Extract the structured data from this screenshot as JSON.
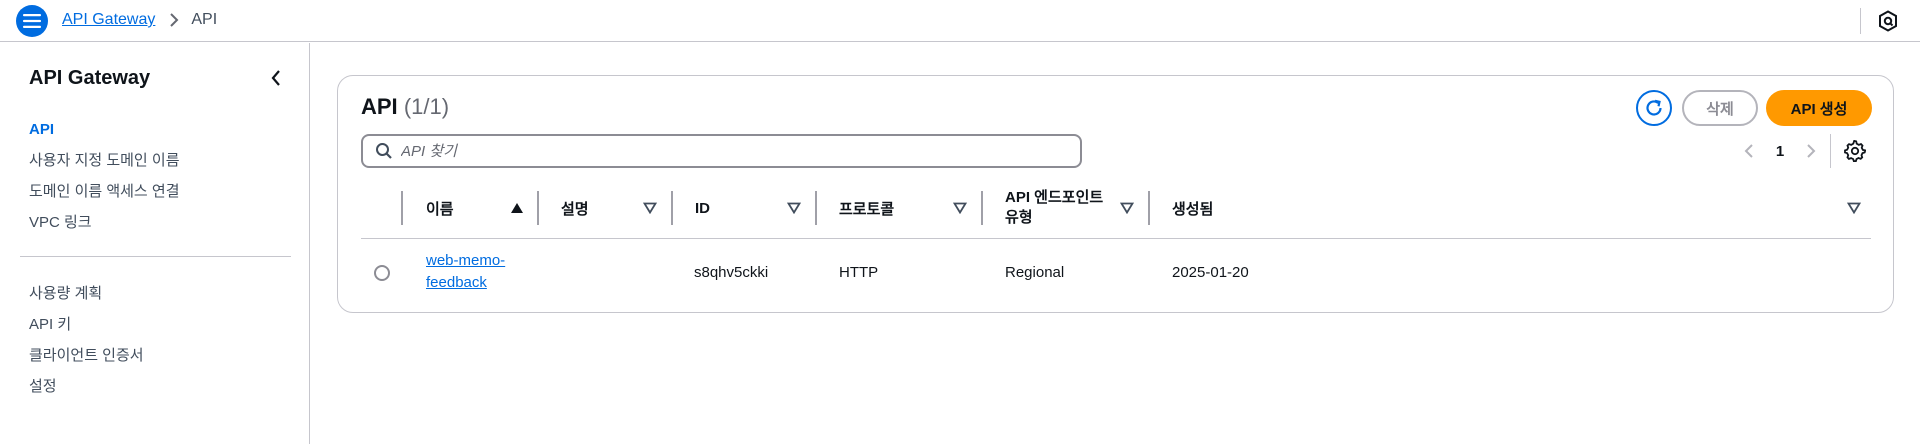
{
  "topbar": {
    "menu_icon": "hamburger-menu-icon",
    "breadcrumb": [
      {
        "label": "API Gateway"
      },
      {
        "label": "API"
      }
    ],
    "separator_icon": "chevron-right-icon",
    "right_icon": "notifications-hex-icon"
  },
  "sidebar": {
    "title": "API Gateway",
    "close_icon": "chevron-left-icon",
    "items": [
      {
        "label": "API",
        "active": true
      },
      {
        "label": "사용자 지정 도메인 이름"
      },
      {
        "label": "도메인 이름 액세스 연결"
      },
      {
        "label": "VPC 링크"
      }
    ],
    "items2": [
      {
        "label": "사용량 계획"
      },
      {
        "label": "API 키"
      },
      {
        "label": "클라이언트 인증서"
      },
      {
        "label": "설정"
      }
    ]
  },
  "main": {
    "title": "API",
    "count": "(1/1)",
    "refresh_icon": "refresh-icon",
    "delete_label": "삭제",
    "create_label": "API 생성",
    "search": {
      "placeholder": "API 찾기",
      "value": ""
    },
    "pagination": {
      "current": "1"
    },
    "settings_icon": "gear-icon",
    "columns": [
      {
        "label": "이름",
        "sort": "ascending"
      },
      {
        "label": "설명",
        "sort": "none"
      },
      {
        "label": "ID",
        "sort": "none"
      },
      {
        "label": "프로토콜",
        "sort": "none"
      },
      {
        "label": "API 엔드포인트 유형",
        "sort": "none"
      },
      {
        "label": "생성됨",
        "sort": "none"
      }
    ],
    "rows": [
      {
        "name_line1": "web-memo-",
        "name_line2": "feedback",
        "description": "",
        "id": "s8qhv5ckki",
        "protocol": "HTTP",
        "endpoint_type": "Regional",
        "created": "2025-01-20"
      }
    ]
  },
  "colors": {
    "accent": "#006ce0",
    "primary_button": "#ff9900",
    "border": "#c6c6cd"
  }
}
